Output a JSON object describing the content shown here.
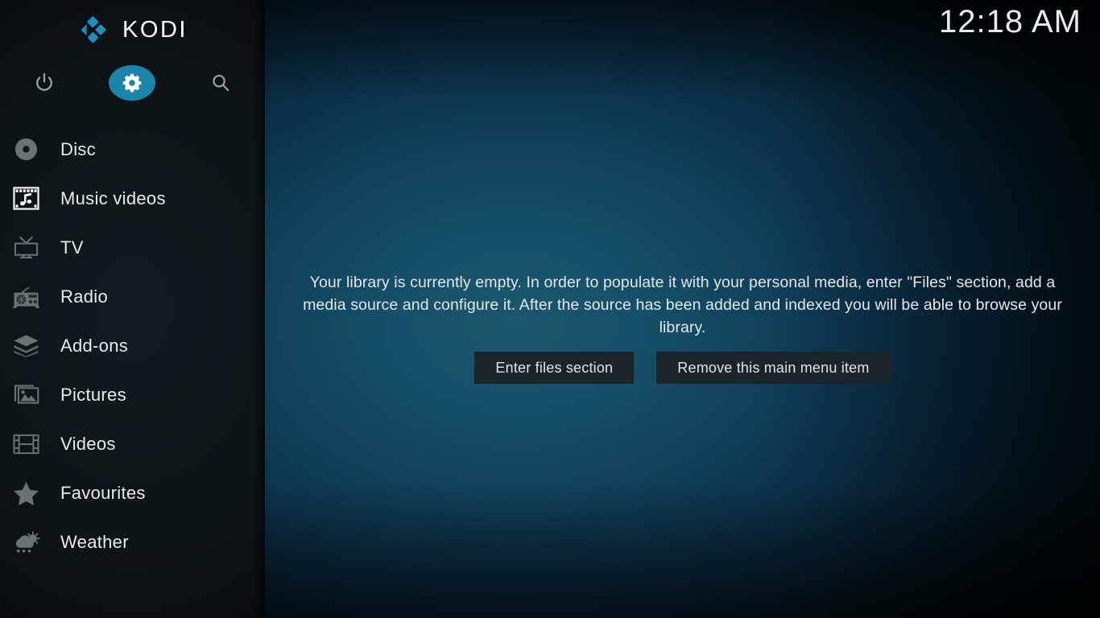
{
  "brand": {
    "name": "KODI",
    "logo_icon": "kodi-logo-icon",
    "accent_color": "#1b84ab"
  },
  "header": {
    "clock": "12:18 AM"
  },
  "sidebar": {
    "top_actions": [
      {
        "name": "power",
        "icon": "power-icon",
        "label": "Power",
        "active": false
      },
      {
        "name": "settings",
        "icon": "gear-icon",
        "label": "Settings",
        "active": true
      },
      {
        "name": "search",
        "icon": "search-icon",
        "label": "Search",
        "active": false
      }
    ],
    "items": [
      {
        "label": "Disc",
        "icon": "disc-icon"
      },
      {
        "label": "Music videos",
        "icon": "music-videos-icon"
      },
      {
        "label": "TV",
        "icon": "tv-icon"
      },
      {
        "label": "Radio",
        "icon": "radio-icon"
      },
      {
        "label": "Add-ons",
        "icon": "addons-icon"
      },
      {
        "label": "Pictures",
        "icon": "pictures-icon"
      },
      {
        "label": "Videos",
        "icon": "videos-icon"
      },
      {
        "label": "Favourites",
        "icon": "star-icon"
      },
      {
        "label": "Weather",
        "icon": "weather-icon"
      }
    ]
  },
  "main": {
    "empty_message": "Your library is currently empty. In order to populate it with your personal media, enter \"Files\" section, add a media source and configure it. After the source has been added and indexed you will be able to browse your library.",
    "buttons": {
      "enter_files": "Enter files section",
      "remove_item": "Remove this main menu item"
    }
  }
}
